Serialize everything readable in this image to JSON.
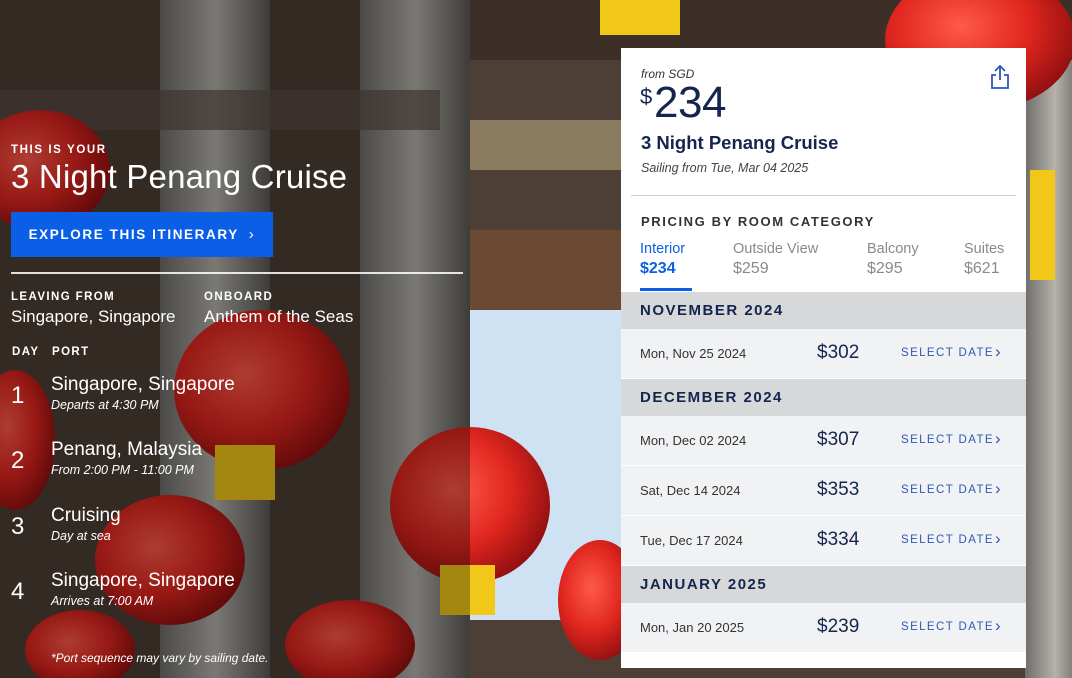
{
  "hero": {
    "eyebrow": "THIS IS YOUR",
    "title": "3 Night Penang Cruise",
    "explore_label": "EXPLORE THIS ITINERARY",
    "leaving_label": "LEAVING FROM",
    "leaving_value": "Singapore, Singapore",
    "onboard_label": "ONBOARD",
    "onboard_value": "Anthem of the Seas",
    "day_label": "DAY",
    "port_label": "PORT",
    "days": [
      {
        "day": "1",
        "port": "Singapore, Singapore",
        "time": "Departs at 4:30 PM"
      },
      {
        "day": "2",
        "port": "Penang, Malaysia",
        "time": "From 2:00 PM - 11:00 PM"
      },
      {
        "day": "3",
        "port": "Cruising",
        "time": "Day at sea"
      },
      {
        "day": "4",
        "port": "Singapore, Singapore",
        "time": "Arrives at 7:00 AM"
      }
    ],
    "footnote": "*Port sequence may vary by sailing date."
  },
  "card": {
    "from_label": "from SGD",
    "currency_symbol": "$",
    "price": "234",
    "cruise_name": "3 Night Penang Cruise",
    "sailing": "Sailing from Tue, Mar 04 2025",
    "pricing_header": "PRICING BY ROOM CATEGORY",
    "share_icon": "share-icon",
    "tabs": [
      {
        "name": "Interior",
        "price": "$234",
        "active": true
      },
      {
        "name": "Outside View",
        "price": "$259",
        "active": false
      },
      {
        "name": "Balcony",
        "price": "$295",
        "active": false
      },
      {
        "name": "Suites",
        "price": "$621",
        "active": false
      }
    ],
    "select_label": "SELECT DATE",
    "months": [
      {
        "name": "NOVEMBER 2024",
        "rows": [
          {
            "date": "Mon, Nov 25 2024",
            "price": "$302"
          }
        ]
      },
      {
        "name": "DECEMBER 2024",
        "rows": [
          {
            "date": "Mon, Dec 02 2024",
            "price": "$307"
          },
          {
            "date": "Sat, Dec 14 2024",
            "price": "$353"
          },
          {
            "date": "Tue, Dec 17 2024",
            "price": "$334"
          }
        ]
      },
      {
        "name": "JANUARY 2025",
        "rows": [
          {
            "date": "Mon, Jan 20 2025",
            "price": "$239"
          }
        ]
      }
    ]
  },
  "colors": {
    "accent_blue": "#0a5fe6",
    "navy": "#15264e",
    "lantern_red": "#d81e1e"
  }
}
